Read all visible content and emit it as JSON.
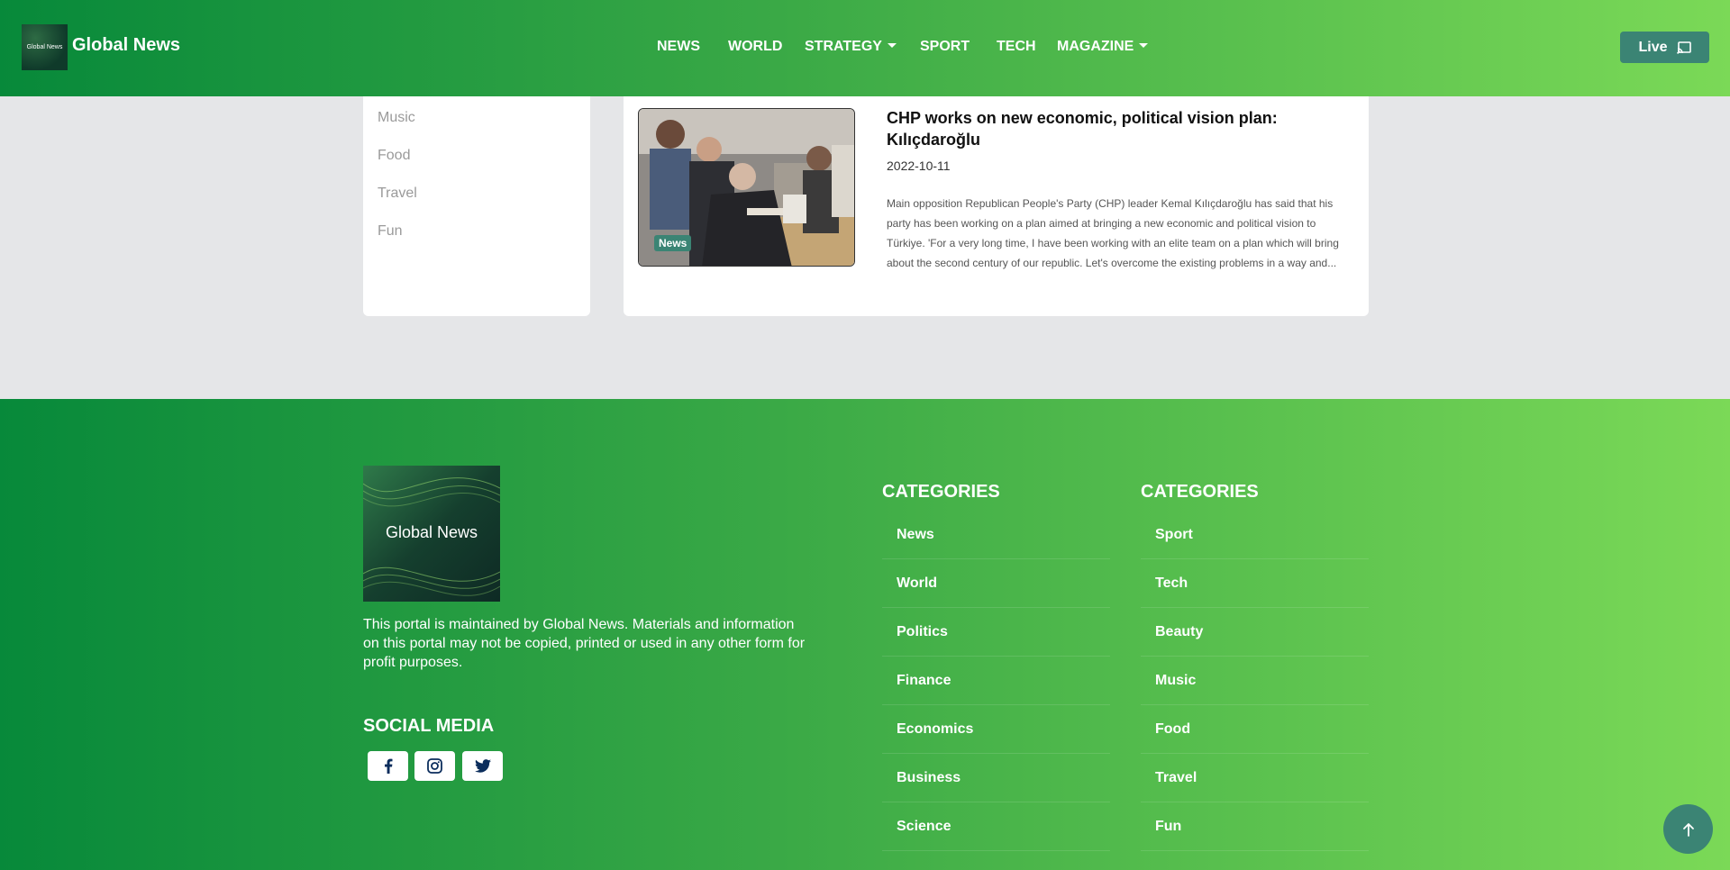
{
  "header": {
    "brand": {
      "logo_text": "Global News",
      "name": "Global News"
    },
    "nav": [
      {
        "label": "NEWS",
        "dropdown": false
      },
      {
        "label": "WORLD",
        "dropdown": false
      },
      {
        "label": "STRATEGY",
        "dropdown": true
      },
      {
        "label": "SPORT",
        "dropdown": false
      },
      {
        "label": "TECH",
        "dropdown": false
      },
      {
        "label": "MAGAZINE",
        "dropdown": true
      }
    ],
    "live_label": "Live",
    "live_icon": "cast-icon"
  },
  "sidebar": {
    "items": [
      {
        "label": "Music"
      },
      {
        "label": "Food"
      },
      {
        "label": "Travel"
      },
      {
        "label": "Fun"
      }
    ]
  },
  "article": {
    "badge": "News",
    "title": "CHP works on new economic, political vision plan: Kılıçdaroğlu",
    "date": "2022-10-11",
    "excerpt": "Main opposition Republican People's Party (CHP) leader Kemal Kılıçdaroğlu has said that his party has been working on a plan aimed at bringing a new economic and political vision to Türkiye. 'For a very long time, I have been working with an elite team on a plan which will bring about the second century of our republic. Let's overcome the existing problems in a way and..."
  },
  "footer": {
    "logo_text": "Global News",
    "about": "This portal is maintained by Global News. Materials and information on this portal may not be copied, printed or used in any other form for profit purposes.",
    "social_title": "SOCIAL MEDIA",
    "social": [
      {
        "icon": "facebook-icon"
      },
      {
        "icon": "instagram-icon"
      },
      {
        "icon": "twitter-icon"
      }
    ],
    "categories": [
      {
        "title": "CATEGORIES",
        "items": [
          "News",
          "World",
          "Politics",
          "Finance",
          "Economics",
          "Business",
          "Science"
        ]
      },
      {
        "title": "CATEGORIES",
        "items": [
          "Sport",
          "Tech",
          "Beauty",
          "Music",
          "Food",
          "Travel",
          "Fun"
        ]
      }
    ]
  },
  "colors": {
    "gradient_start": "#07893a",
    "gradient_end": "#7bd957",
    "accent": "#3b8474",
    "page_bg": "#e5e6e8"
  }
}
